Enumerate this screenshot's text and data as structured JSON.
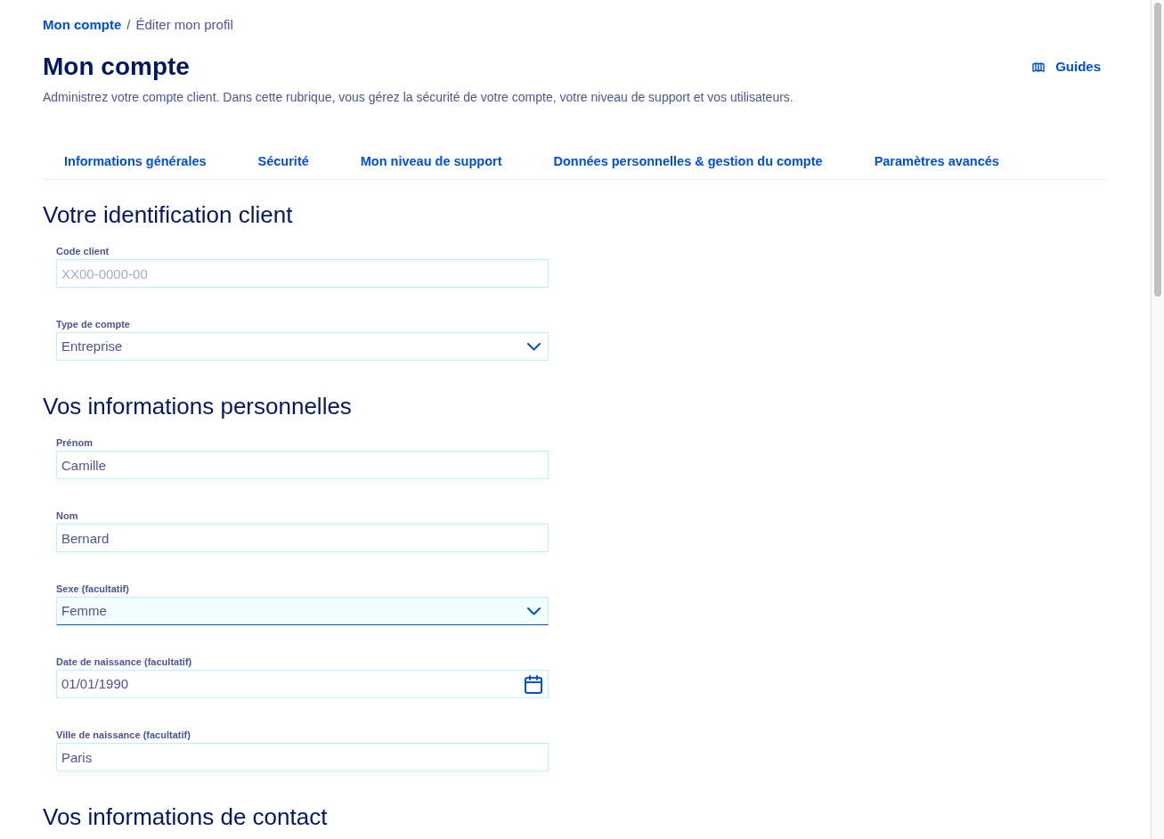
{
  "breadcrumb": {
    "items": [
      {
        "label": "Mon compte",
        "kind": "link"
      },
      {
        "label": "Éditer mon profil",
        "kind": "current"
      }
    ],
    "separator": "/"
  },
  "header": {
    "title": "Mon compte",
    "guides_link": "Guides",
    "description": "Administrez votre compte client. Dans cette rubrique, vous gérez la sécurité de votre compte, votre niveau de support et vos utilisateurs."
  },
  "tabs": [
    {
      "label": "Informations générales",
      "selected": false
    },
    {
      "label": "Sécurité",
      "selected": false
    },
    {
      "label": "Mon niveau de support",
      "selected": false
    },
    {
      "label": "Données personnelles & gestion du compte",
      "selected": false
    },
    {
      "label": "Paramètres avancés",
      "selected": false
    }
  ],
  "sections": [
    {
      "title": "Votre identification client",
      "fields": [
        {
          "kind": "text",
          "label": "Code client",
          "placeholder": "XX00-0000-00",
          "focused": false
        },
        {
          "kind": "select",
          "label": "Type de compte",
          "value": "Entreprise",
          "focused": false
        }
      ]
    },
    {
      "title": "Vos informations personnelles",
      "fields": [
        {
          "kind": "text",
          "label": "Prénom",
          "value": "Camille",
          "focused": false
        },
        {
          "kind": "text",
          "label": "Nom",
          "value": "Bernard",
          "focused": false
        },
        {
          "kind": "select",
          "label": "Sexe (facultatif)",
          "value": "Femme",
          "focused": true
        },
        {
          "kind": "date",
          "label": "Date de naissance (facultatif)",
          "value": "01/01/1990",
          "focused": false
        },
        {
          "kind": "text",
          "label": "Ville de naissance (facultatif)",
          "value": "Paris",
          "focused": false
        }
      ]
    },
    {
      "title": "Vos informations de contact"
    }
  ]
}
